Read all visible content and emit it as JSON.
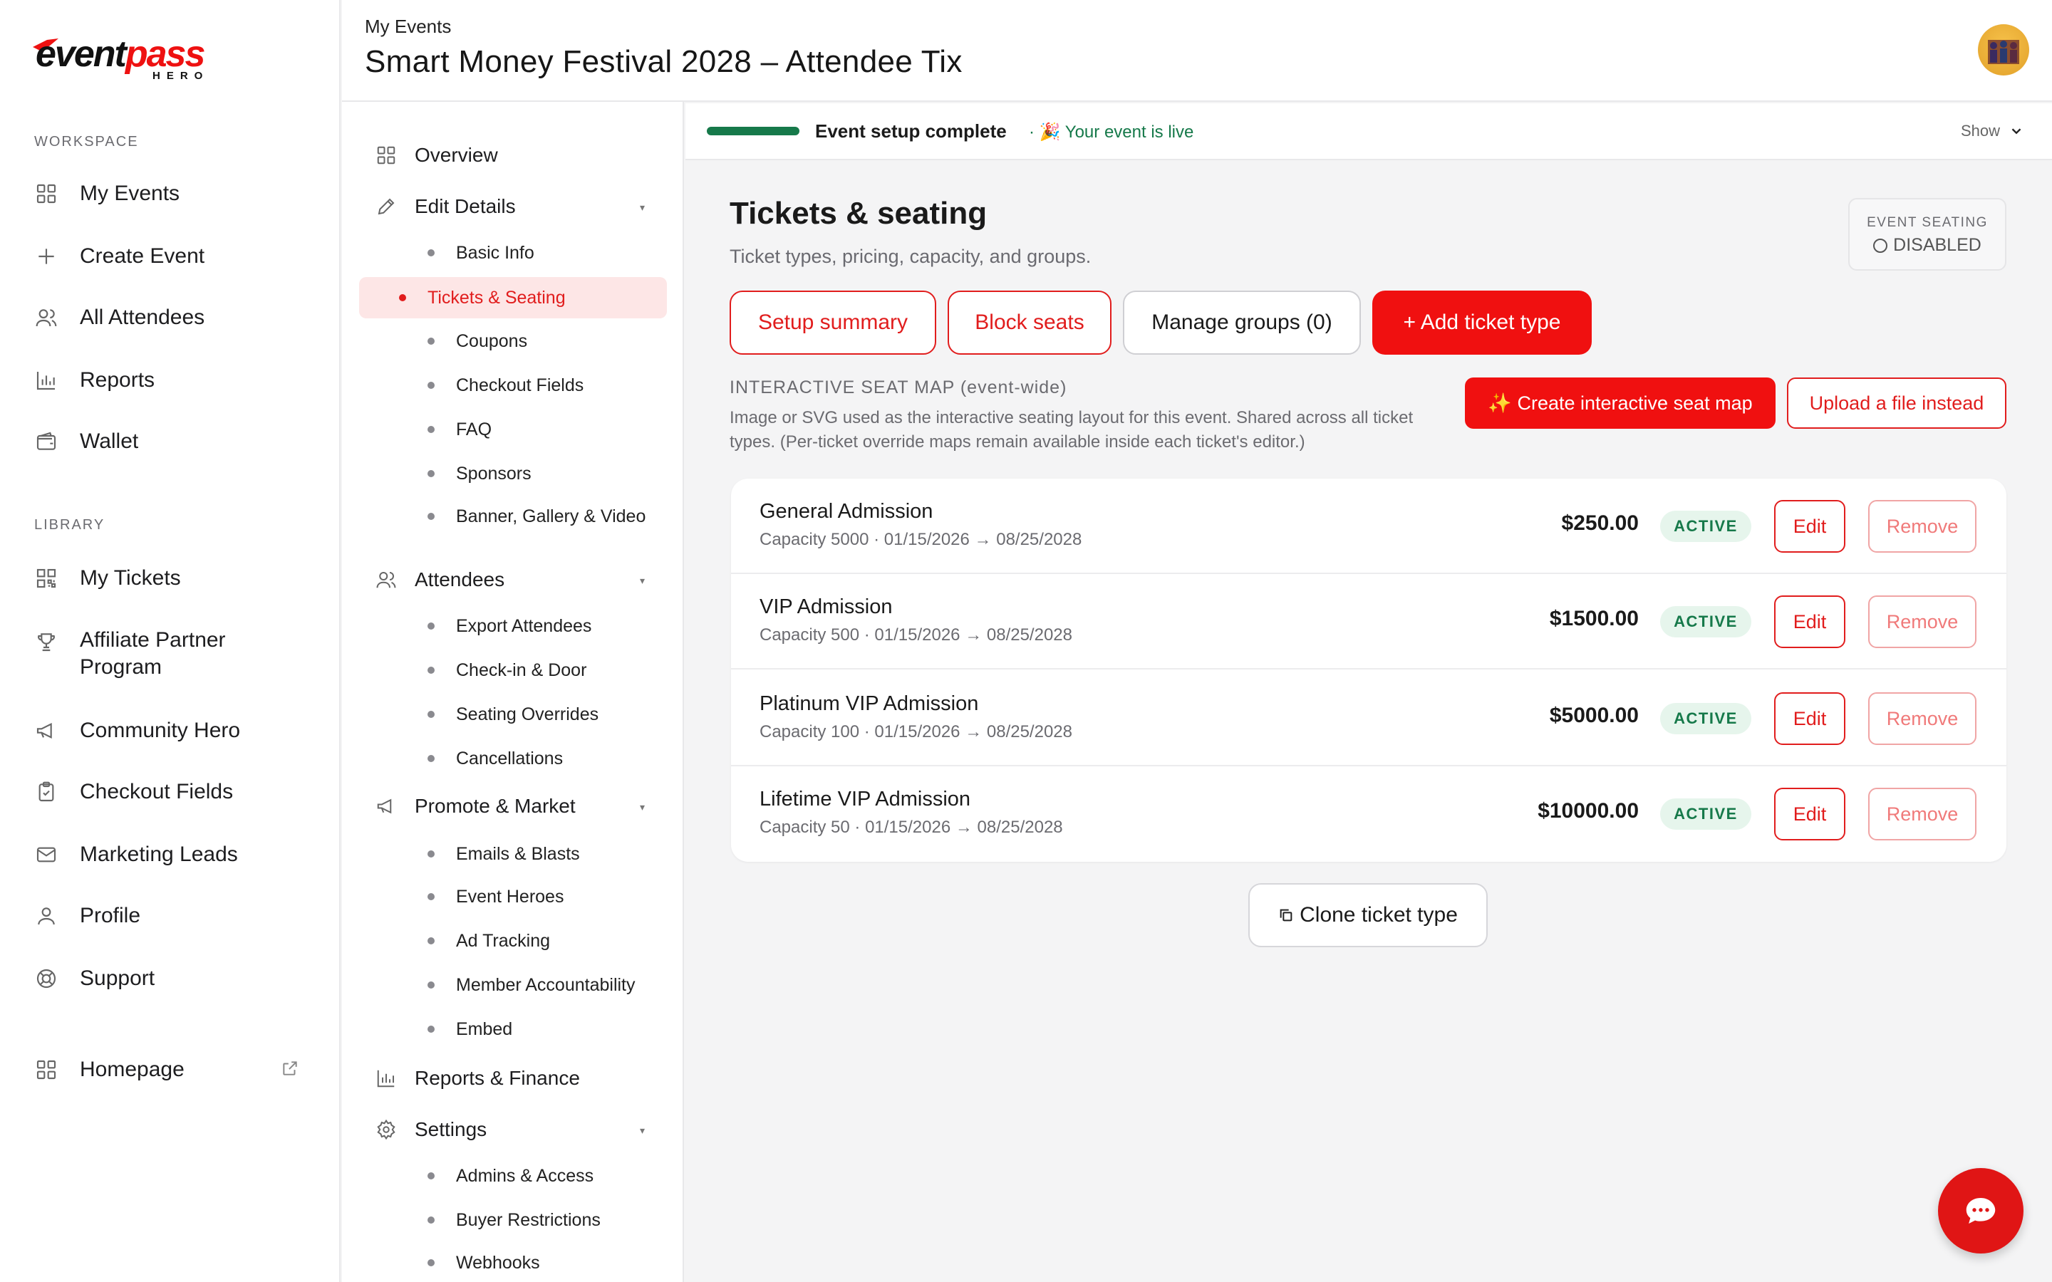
{
  "brand": {
    "logo_prefix": "event",
    "logo_suffix": "pass",
    "logo_sub": "HERO"
  },
  "sidebar": {
    "workspace_title": "WORKSPACE",
    "workspace_items": [
      {
        "label": "My Events",
        "icon": "grid-icon"
      },
      {
        "label": "Create Event",
        "icon": "plus-icon"
      },
      {
        "label": "All Attendees",
        "icon": "users-icon"
      },
      {
        "label": "Reports",
        "icon": "bar-chart-icon"
      },
      {
        "label": "Wallet",
        "icon": "wallet-icon"
      }
    ],
    "library_title": "LIBRARY",
    "library_items": [
      {
        "label": "My Tickets",
        "icon": "qr-icon"
      },
      {
        "label": "Affiliate Partner Program",
        "icon": "trophy-icon"
      },
      {
        "label": "Community Hero",
        "icon": "megaphone-icon"
      },
      {
        "label": "Checkout Fields",
        "icon": "clipboard-icon"
      },
      {
        "label": "Marketing Leads",
        "icon": "mail-icon"
      },
      {
        "label": "Profile",
        "icon": "user-icon"
      },
      {
        "label": "Support",
        "icon": "lifebuoy-icon"
      }
    ],
    "homepage": "Homepage"
  },
  "header": {
    "breadcrumb": "My Events",
    "title": "Smart Money Festival 2028 – Attendee Tix"
  },
  "subnav": {
    "overview": "Overview",
    "edit_details": "Edit Details",
    "edit_children": [
      "Basic Info",
      "Tickets & Seating",
      "Coupons",
      "Checkout Fields",
      "FAQ",
      "Sponsors",
      "Banner, Gallery & Video"
    ],
    "attendees": "Attendees",
    "attendee_children": [
      "Export Attendees",
      "Check-in & Door",
      "Seating Overrides",
      "Cancellations"
    ],
    "promote": "Promote & Market",
    "promote_children": [
      "Emails & Blasts",
      "Event Heroes",
      "Ad Tracking",
      "Member Accountability",
      "Embed"
    ],
    "reports": "Reports & Finance",
    "settings": "Settings",
    "settings_children": [
      "Admins & Access",
      "Buyer Restrictions",
      "Webhooks"
    ]
  },
  "progress": {
    "label": "Event setup complete",
    "live": "· 🎉 Your event is live",
    "show": "Show",
    "accent": "#16794a"
  },
  "main": {
    "title": "Tickets & seating",
    "subtitle": "Ticket types, pricing, capacity, and groups.",
    "seating_label": "EVENT SEATING",
    "seating_value": "DISABLED",
    "buttons": {
      "setup_summary": "Setup summary",
      "block_seats": "Block seats",
      "manage_groups": "Manage groups (0)",
      "add_ticket": "+ Add ticket type"
    },
    "seat_map": {
      "label": "INTERACTIVE SEAT MAP (event-wide)",
      "description": "Image or SVG used as the interactive seating layout for this event. Shared across all ticket types. (Per-ticket override maps remain available inside each ticket's editor.)",
      "create": "✨ Create interactive seat map",
      "upload": "Upload a file instead"
    },
    "tickets": [
      {
        "name": "General Admission",
        "meta": "Capacity 5000 · 01/15/2026 → 08/25/2028",
        "price": "$250.00",
        "status": "ACTIVE"
      },
      {
        "name": "VIP Admission",
        "meta": "Capacity 500 · 01/15/2026 → 08/25/2028",
        "price": "$1500.00",
        "status": "ACTIVE"
      },
      {
        "name": "Platinum VIP Admission",
        "meta": "Capacity 100 · 01/15/2026 → 08/25/2028",
        "price": "$5000.00",
        "status": "ACTIVE"
      },
      {
        "name": "Lifetime VIP Admission",
        "meta": "Capacity 50 · 01/15/2026 → 08/25/2028",
        "price": "$10000.00",
        "status": "ACTIVE"
      }
    ],
    "edit_label": "Edit",
    "remove_label": "Remove",
    "clone_label": "Clone ticket type",
    "brand_color": "#f01010"
  }
}
